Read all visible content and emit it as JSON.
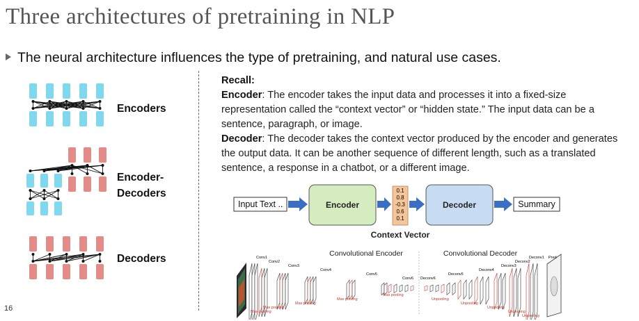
{
  "title": "Three architectures of pretraining in NLP",
  "bullet": "The neural architecture influences the type of pretraining, and natural use cases.",
  "architectures": {
    "encoders": "Encoders",
    "encoder_decoders_line1": "Encoder-",
    "encoder_decoders_line2": "Decoders",
    "decoders": "Decoders"
  },
  "recall": {
    "heading": "Recall:",
    "encoder_term": "Encoder",
    "encoder_text": ": The encoder takes the input data and processes it into a fixed-size representation called the “context vector” or “hidden state.” The input data can be a sentence, paragraph, or image.",
    "decoder_term": "Decoder",
    "decoder_text": ": The decoder takes the context vector produced by the encoder and generates the output data. It can be another sequence of different length, such as a translated sentence, a response in a chatbot, or a different image."
  },
  "pipeline": {
    "input": "Input Text ..",
    "encoder": "Encoder",
    "context_values": [
      "0.1",
      "0.8",
      "-0.3",
      "0.6",
      "0.1"
    ],
    "decoder": "Decoder",
    "output": "Summary",
    "context_label": "Context Vector"
  },
  "conv": {
    "encoder_title": "Convolutional Encoder",
    "decoder_title": "Convolutional Decoder",
    "layers": [
      "Conv1",
      "Conv2",
      "Conv3",
      "Conv4",
      "Conv5",
      "Conv6",
      "Deconv6",
      "Deconv5",
      "Deconv4",
      "Deconv3",
      "Deconv2",
      "Deconv1",
      "Pred"
    ],
    "max_pooling": "Max pooling",
    "unpooling": "Unpooling"
  },
  "page_number": "16",
  "colors": {
    "encoder_block": "#7fd8ee",
    "decoder_block": "#e38b86",
    "encoder_box": "#d4ecc0",
    "decoder_box": "#c7dcf2",
    "arrow": "#3b6fc4",
    "context": "#f5c59a"
  }
}
